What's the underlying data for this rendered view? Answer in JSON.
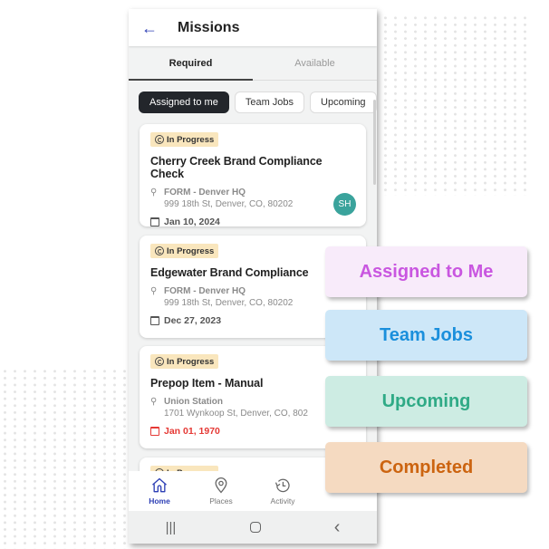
{
  "header": {
    "title": "Missions",
    "back_icon": "arrow-left"
  },
  "tabs": [
    {
      "label": "Required",
      "active": true
    },
    {
      "label": "Available",
      "active": false
    }
  ],
  "filters": [
    {
      "label": "Assigned to me",
      "active": true
    },
    {
      "label": "Team Jobs",
      "active": false
    },
    {
      "label": "Upcoming",
      "active": false
    }
  ],
  "missions": [
    {
      "status": "In Progress",
      "title": "Cherry Creek Brand Compliance Check",
      "location_name": "FORM - Denver HQ",
      "address": "999 18th St, Denver, CO, 80202",
      "date": "Jan 10, 2024",
      "overdue": false,
      "assignee_initials": "SH"
    },
    {
      "status": "In Progress",
      "title": "Edgewater Brand Compliance",
      "location_name": "FORM - Denver HQ",
      "address": "999 18th St, Denver, CO, 80202",
      "date": "Dec 27, 2023",
      "overdue": false
    },
    {
      "status": "In Progress",
      "title": "Prepop Item - Manual",
      "location_name": "Union Station",
      "address": "1701 Wynkoop St, Denver, CO, 802",
      "date": "Jan 01, 1970",
      "overdue": true
    },
    {
      "status": "In Progress"
    }
  ],
  "bottom_nav": [
    {
      "label": "Home",
      "icon": "home-icon",
      "active": true
    },
    {
      "label": "Places",
      "icon": "map-pin-icon",
      "active": false
    },
    {
      "label": "Activity",
      "icon": "history-icon",
      "active": false
    }
  ],
  "system_nav": {
    "recents": "|||",
    "back": "‹"
  },
  "callouts": [
    {
      "label": "Assigned to Me",
      "bg": "#f8ebfa",
      "color": "#c956e0"
    },
    {
      "label": "Team Jobs",
      "bg": "#cde7f8",
      "color": "#1a8fdc"
    },
    {
      "label": "Upcoming",
      "bg": "#cdece3",
      "color": "#2faa86"
    },
    {
      "label": "Completed",
      "bg": "#f5dac1",
      "color": "#cc6410"
    }
  ],
  "colors": {
    "accent": "#2d3fb5",
    "badge_bg": "#f9e6bd",
    "avatar": "#3aa39c",
    "overdue": "#e53935"
  }
}
